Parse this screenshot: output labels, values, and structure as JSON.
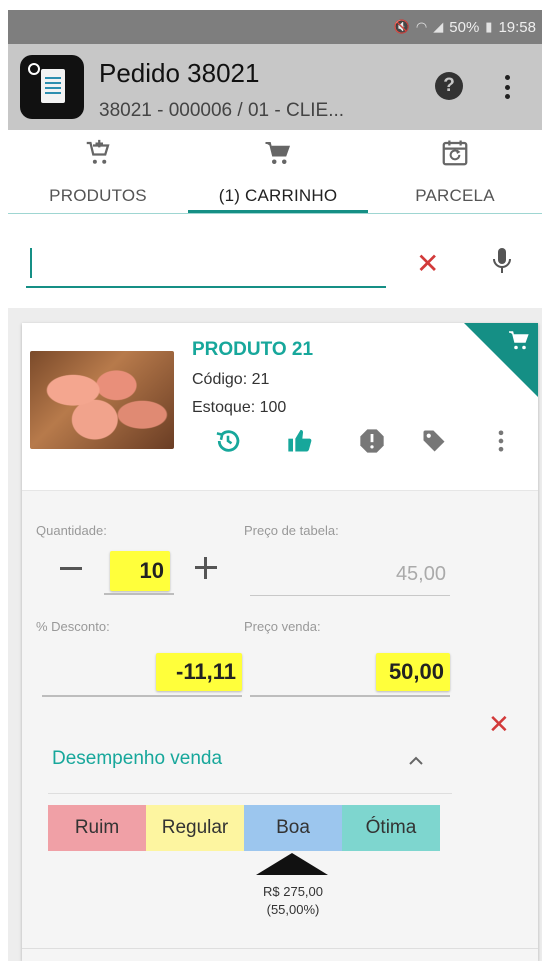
{
  "status_bar": {
    "battery": "50%",
    "time": "19:58"
  },
  "app_bar": {
    "title": "Pedido 38021",
    "subtitle": "38021 - 000006 / 01 - CLIE..."
  },
  "tabs": [
    {
      "label": "PRODUTOS",
      "icon": "cart-add-icon"
    },
    {
      "label": "(1) CARRINHO",
      "icon": "cart-icon",
      "active": true
    },
    {
      "label": "PARCELA",
      "icon": "calendar-refresh-icon"
    }
  ],
  "search": {
    "value": "",
    "placeholder": ""
  },
  "product": {
    "name": "PRODUTO 21",
    "code": "Código: 21",
    "stock": "Estoque: 100",
    "actions": [
      "history-icon",
      "thumbs-up-icon",
      "alert-icon",
      "tag-icon",
      "more-vertical-icon"
    ]
  },
  "fields": {
    "quantity_label": "Quantidade:",
    "quantity_value": "10",
    "table_price_label": "Preço de tabela:",
    "table_price_value": "45,00",
    "discount_label": "% Desconto:",
    "discount_value": "-11,11",
    "sale_price_label": "Preço venda:",
    "sale_price_value": "50,00"
  },
  "performance": {
    "title": "Desempenho venda",
    "segments": [
      {
        "label": "Ruim",
        "color": "#f0a0a6"
      },
      {
        "label": "Regular",
        "color": "#fdf5a0"
      },
      {
        "label": "Boa",
        "color": "#9cc6ee"
      },
      {
        "label": "Ótima",
        "color": "#7ed6cf"
      }
    ],
    "selected": "Boa",
    "value_amount": "R$ 275,00",
    "value_percent": "(55,00%)"
  },
  "colors": {
    "accent": "#158f85",
    "highlight": "#ffff3b",
    "danger": "#d23a3a"
  }
}
